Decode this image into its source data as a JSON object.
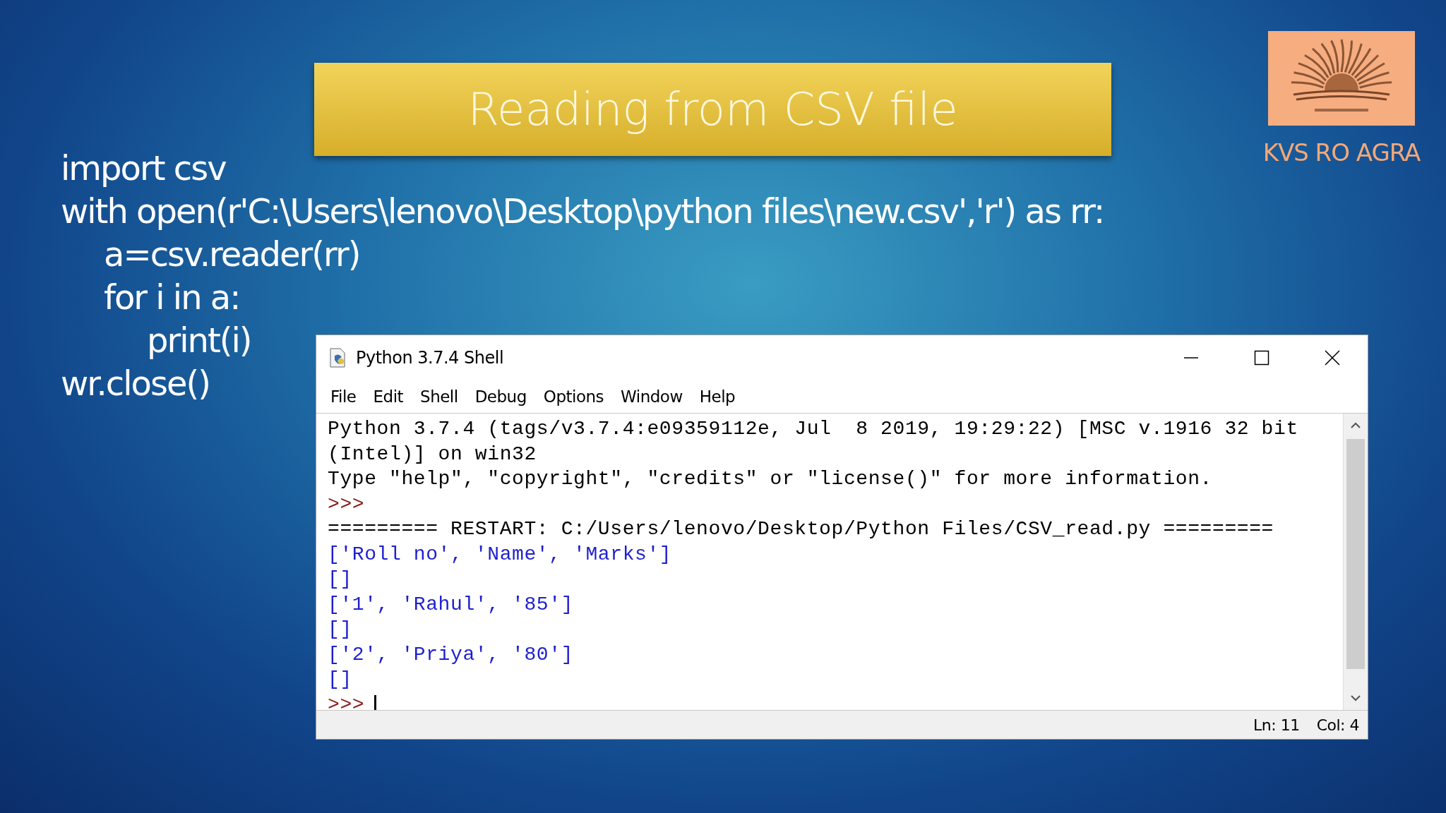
{
  "slide": {
    "title": "Reading from CSV file",
    "code": [
      {
        "text": "import csv"
      },
      {
        "text": "with open(r'C:\\Users\\lenovo\\Desktop\\python files\\new.csv','r') as rr:",
        "children": [
          {
            "text": "a=csv.reader(rr)"
          },
          {
            "text": "for i in a:",
            "children": [
              {
                "text": "print(i)"
              }
            ]
          }
        ]
      },
      {
        "text": "wr.close()"
      }
    ],
    "logo": {
      "caption": "KVS RO AGRA"
    }
  },
  "shell": {
    "window": {
      "title": "Python 3.7.4 Shell"
    },
    "menu": [
      "File",
      "Edit",
      "Shell",
      "Debug",
      "Options",
      "Window",
      "Help"
    ],
    "lines": [
      {
        "kind": "text",
        "text": "Python 3.7.4 (tags/v3.7.4:e09359112e, Jul  8 2019, 19:29:22) [MSC v.1916 32 bit"
      },
      {
        "kind": "text",
        "text": "(Intel)] on win32"
      },
      {
        "kind": "text",
        "text": "Type \"help\", \"copyright\", \"credits\" or \"license()\" for more information."
      },
      {
        "kind": "prompt",
        "text": ">>>"
      },
      {
        "kind": "text",
        "text": "========= RESTART: C:/Users/lenovo/Desktop/Python Files/CSV_read.py ========="
      },
      {
        "kind": "output",
        "text": "['Roll no', 'Name', 'Marks']"
      },
      {
        "kind": "output",
        "text": "[]"
      },
      {
        "kind": "output",
        "text": "['1', 'Rahul', '85']"
      },
      {
        "kind": "output",
        "text": "[]"
      },
      {
        "kind": "output",
        "text": "['2', 'Priya', '80']"
      },
      {
        "kind": "output",
        "text": "[]"
      },
      {
        "kind": "input",
        "text": ">>>"
      }
    ],
    "status_bar": [
      "Ln: 11",
      "Col: 4"
    ]
  }
}
